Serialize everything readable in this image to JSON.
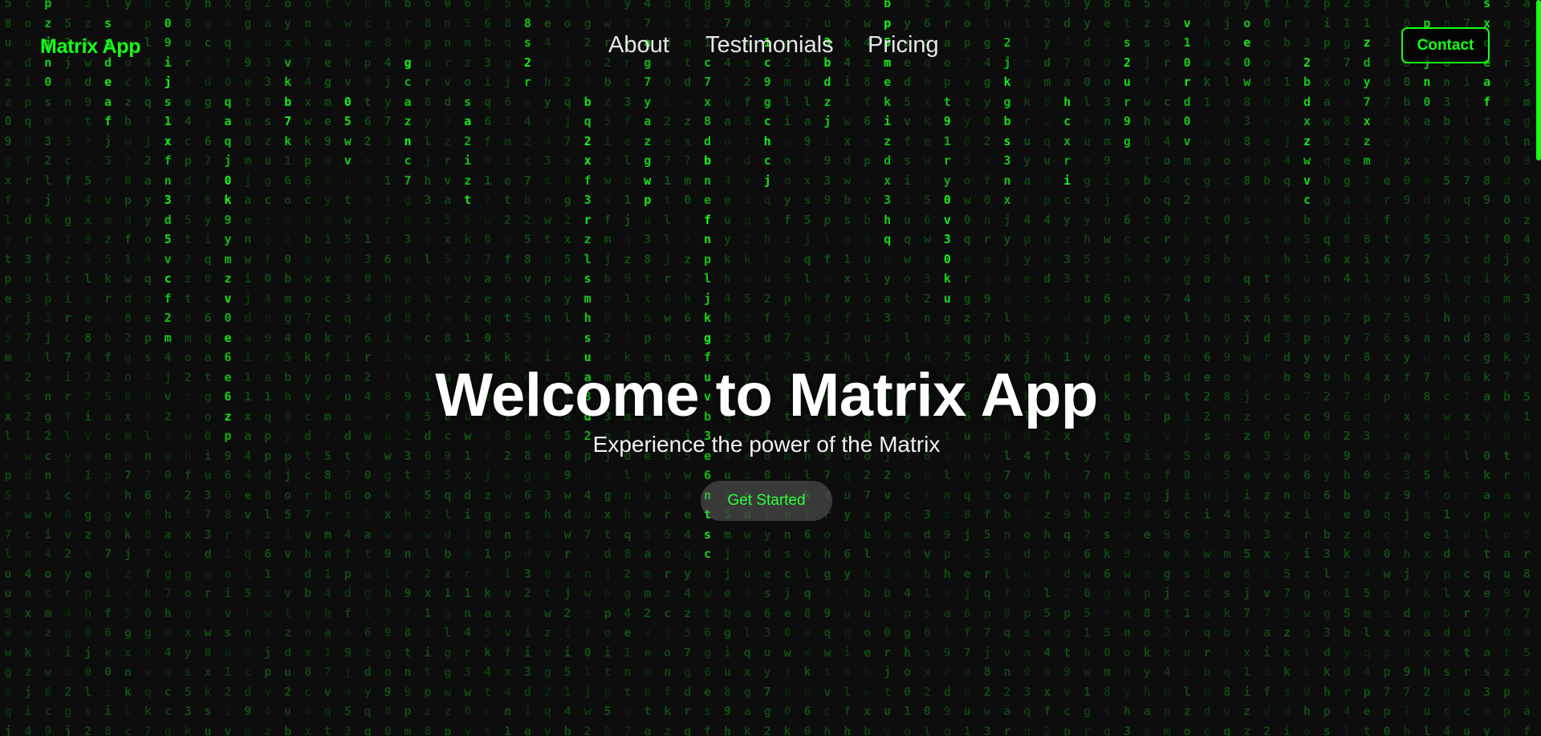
{
  "app": {
    "logo_text": "Matrix App",
    "brand_color": "#16ff16",
    "background_color": "#0d0d0d"
  },
  "nav": {
    "links": [
      {
        "label": "About"
      },
      {
        "label": "Testimonials"
      },
      {
        "label": "Pricing"
      }
    ],
    "contact_label": "Contact"
  },
  "hero": {
    "title": "Welcome to Matrix App",
    "subtitle": "Experience the power of the Matrix",
    "cta_label": "Get Started"
  },
  "background": {
    "effect": "matrix-digital-rain",
    "glyph_color": "#16ff16",
    "columns": [
      "pzjn0",
      "sxdeaf",
      "09ijs1xfn3d5vcf2m",
      "qaqj0k9ymzv0e6e6zp",
      "vkb7k",
      "05wv",
      "gcaznc7",
      "sa2izt",
      "8s2r",
      "bq2xf3rzlsmhsua8d2",
      "ag7yazgwp",
      "c7x8dbnefnpljkgfuvb3e6ntsc",
      "1c9gchcj",
      "3bdzj",
      "bp5mekizdx3hq",
      "t91ry0v30ku",
      "2jkgbs3nx",
      "hcxri",
      "s2ur9g",
      "v10rd0v",
      "oe0w",
      "2bdxzwvc",
      "zdy7xzm"
    ]
  }
}
